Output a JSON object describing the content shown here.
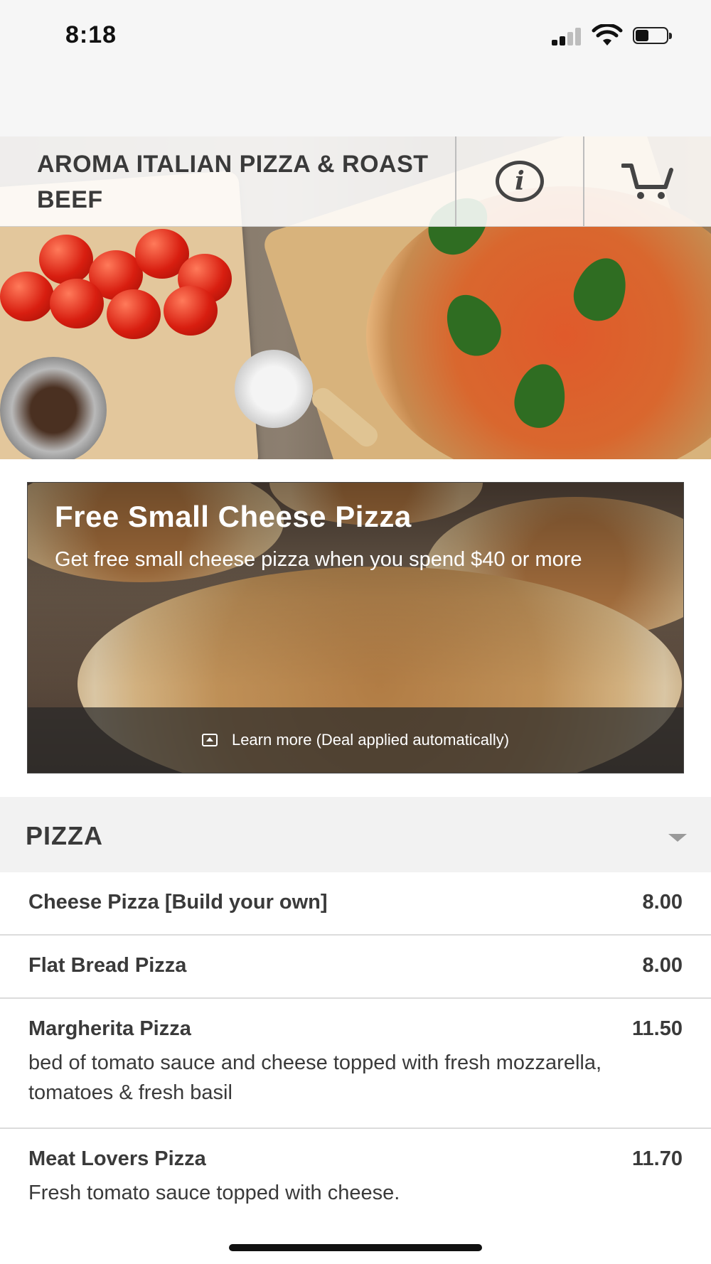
{
  "status_bar": {
    "time": "8:18"
  },
  "header": {
    "title": "AROMA ITALIAN PIZZA & ROAST BEEF",
    "info_icon": "info-icon",
    "cart_icon": "cart-icon"
  },
  "promo": {
    "title": "Free Small Cheese Pizza",
    "description": "Get free small cheese pizza when you spend $40 or more",
    "footer_text": "Learn more (Deal applied automatically)"
  },
  "section": {
    "title": "PIZZA"
  },
  "menu_items": [
    {
      "name": "Cheese Pizza [Build your own]",
      "price": "8.00",
      "description": ""
    },
    {
      "name": "Flat Bread Pizza",
      "price": "8.00",
      "description": ""
    },
    {
      "name": "Margherita Pizza",
      "price": "11.50",
      "description": "bed of tomato sauce and cheese topped with fresh mozzarella, tomatoes & fresh basil"
    },
    {
      "name": "Meat Lovers Pizza",
      "price": "11.70",
      "description": "Fresh tomato sauce topped with cheese."
    }
  ]
}
